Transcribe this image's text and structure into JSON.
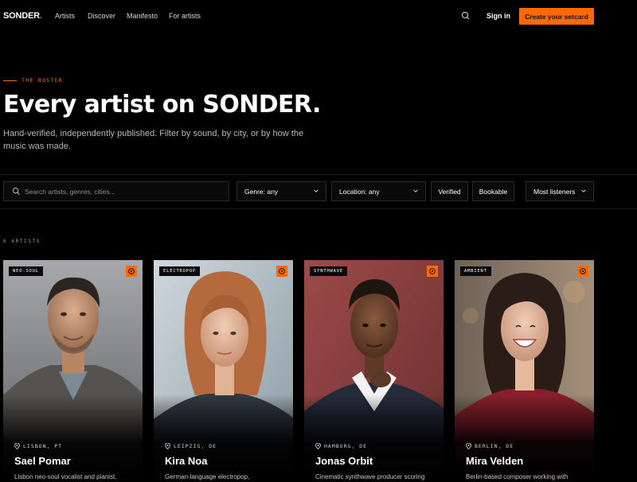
{
  "nav": {
    "logo_text": "SONDER",
    "logo_dot": ".",
    "links": [
      "Artists",
      "Discover",
      "Manifesto",
      "For artists"
    ],
    "sign_in": "Sign in",
    "cta": "Create your setcard",
    "search_icon": "search-icon"
  },
  "hero": {
    "eyebrow": "THE ROSTER",
    "title": "Every artist on SONDER.",
    "subtitle": "Hand-verified, independently published. Filter by sound, by city, or by how the music was made."
  },
  "filters": {
    "search_placeholder": "Search artists, genres, cities...",
    "genre": "Genre: any",
    "location": "Location: any",
    "verified": "Verified",
    "bookable": "Bookable",
    "sort": "Most listeners"
  },
  "results": {
    "count": "6 ARTISTS"
  },
  "artists": [
    {
      "tag": "NEO-SOUL",
      "location": "LISBON, PT",
      "name": "Sael Pomar",
      "desc": "Lisbon neo-soul vocalist and pianist."
    },
    {
      "tag": "ELECTROPOP",
      "location": "LEIPZIG, DE",
      "name": "Kira Noa",
      "desc": "German-language electropop,"
    },
    {
      "tag": "SYNTHWAVE",
      "location": "HAMBURG, DE",
      "name": "Jonas Orbit",
      "desc": "Cinematic synthwave producer scoring"
    },
    {
      "tag": "AMBIENT",
      "location": "BERLIN, DE",
      "name": "Mira Velden",
      "desc": "Berlin-based composer working with"
    }
  ],
  "colors": {
    "accent": "#ff6a00",
    "background": "#000000"
  }
}
